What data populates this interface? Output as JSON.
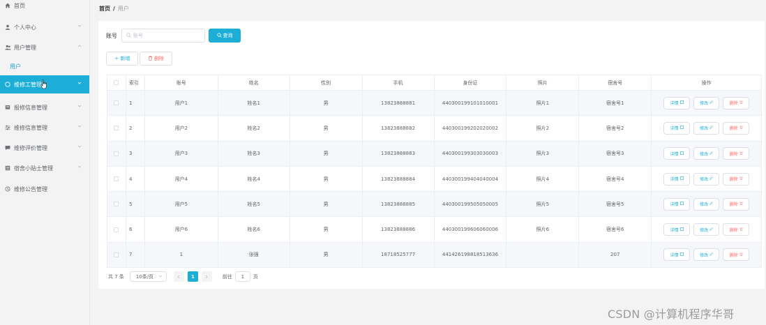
{
  "sidebar": {
    "items": [
      {
        "label": "首页",
        "icon": "home-icon",
        "has_chevron": false
      },
      {
        "label": "个人中心",
        "icon": "user-icon",
        "has_chevron": true
      },
      {
        "label": "用户管理",
        "icon": "users-icon",
        "has_chevron": true,
        "expanded": true
      },
      {
        "label": "维修工管理",
        "icon": "grid-icon",
        "has_chevron": true,
        "active": true
      },
      {
        "label": "报修信息管理",
        "icon": "document-icon",
        "has_chevron": true
      },
      {
        "label": "维修信息管理",
        "icon": "sliders-icon",
        "has_chevron": true
      },
      {
        "label": "维修评价管理",
        "icon": "comment-icon",
        "has_chevron": true
      },
      {
        "label": "宿舍小贴士管理",
        "icon": "list-icon",
        "has_chevron": true
      },
      {
        "label": "维修公告管理",
        "icon": "bell-icon",
        "has_chevron": true
      }
    ],
    "sub_item": "用户"
  },
  "breadcrumb": {
    "home": "首页",
    "separator": "/",
    "current": "用户"
  },
  "search": {
    "label": "账号",
    "placeholder": "账号",
    "button": "查询"
  },
  "actions": {
    "add": "新增",
    "delete": "删除"
  },
  "table": {
    "columns": [
      "索引",
      "账号",
      "姓名",
      "性别",
      "手机",
      "身份证",
      "照片",
      "宿舍号",
      "操作"
    ],
    "rows": [
      {
        "index": "1",
        "account": "用户1",
        "name": "姓名1",
        "gender": "男",
        "phone": "13823888881",
        "id_card": "440300199101010001",
        "photo": "照片1",
        "dorm": "宿舍号1"
      },
      {
        "index": "2",
        "account": "用户2",
        "name": "姓名2",
        "gender": "男",
        "phone": "13823888882",
        "id_card": "440300199202020002",
        "photo": "照片2",
        "dorm": "宿舍号2"
      },
      {
        "index": "3",
        "account": "用户3",
        "name": "姓名3",
        "gender": "男",
        "phone": "13823888883",
        "id_card": "440300199303030003",
        "photo": "照片3",
        "dorm": "宿舍号3"
      },
      {
        "index": "4",
        "account": "用户4",
        "name": "姓名4",
        "gender": "男",
        "phone": "13823888884",
        "id_card": "440300199404040004",
        "photo": "照片4",
        "dorm": "宿舍号4"
      },
      {
        "index": "5",
        "account": "用户5",
        "name": "姓名5",
        "gender": "男",
        "phone": "13823888885",
        "id_card": "440300199505050005",
        "photo": "照片5",
        "dorm": "宿舍号5"
      },
      {
        "index": "6",
        "account": "用户6",
        "name": "姓名6",
        "gender": "男",
        "phone": "13823888886",
        "id_card": "440300199606060006",
        "photo": "照片6",
        "dorm": "宿舍号6"
      },
      {
        "index": "7",
        "account": "1",
        "name": "张强",
        "gender": "男",
        "phone": "18718525777",
        "id_card": "441426198818513636",
        "photo": "",
        "dorm": "207"
      }
    ],
    "row_actions": {
      "detail": "详情",
      "edit": "修改",
      "remove": "删除"
    }
  },
  "pagination": {
    "total": "共 7 条",
    "page_size": "10条/页",
    "current_page": "1",
    "goto_label": "前往",
    "goto_value": "1",
    "page_suffix": "页"
  },
  "watermark": "CSDN @计算机程序华哥",
  "colors": {
    "accent": "#1caed7",
    "danger": "#f56c6c"
  }
}
